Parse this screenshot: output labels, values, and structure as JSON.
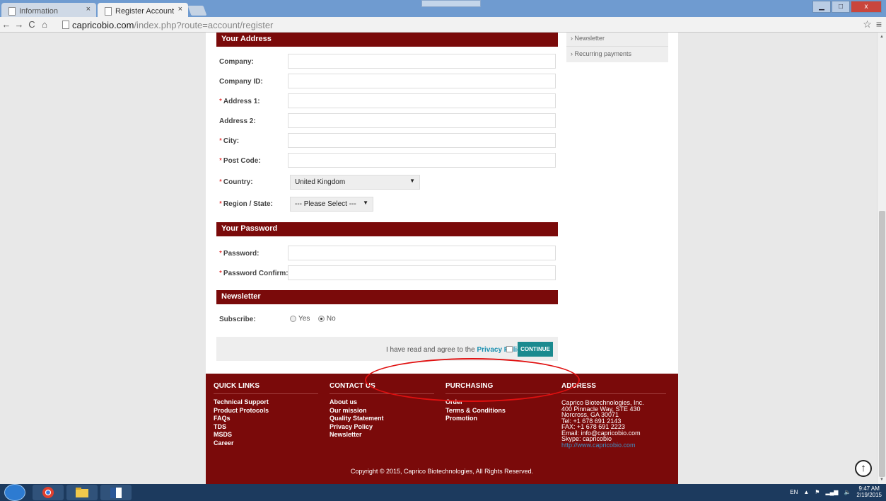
{
  "browser": {
    "tabs": [
      {
        "label": "Information"
      },
      {
        "label": "Register Account"
      }
    ],
    "close_glyph": "×",
    "url_host": "capricobio.com",
    "url_path": "/index.php?route=account/register",
    "win_controls": {
      "minimize": "▁",
      "maximize": "□",
      "close": "x"
    }
  },
  "sidebar": {
    "items": [
      {
        "label": "Newsletter"
      },
      {
        "label": "Recurring payments"
      }
    ]
  },
  "address_section": {
    "title": "Your Address",
    "fields": [
      {
        "label": "Company:",
        "required": false
      },
      {
        "label": "Company ID:",
        "required": false
      },
      {
        "label": "Address 1:",
        "required": true
      },
      {
        "label": "Address 2:",
        "required": false
      },
      {
        "label": "City:",
        "required": true
      },
      {
        "label": "Post Code:",
        "required": true
      }
    ],
    "country_label": "Country:",
    "country_value": "United Kingdom",
    "region_label": "Region / State:",
    "region_value": "--- Please Select ---"
  },
  "password_section": {
    "title": "Your Password",
    "password_label": "Password:",
    "confirm_label": "Password Confirm:"
  },
  "newsletter_section": {
    "title": "Newsletter",
    "subscribe_label": "Subscribe:",
    "yes_label": "Yes",
    "no_label": "No",
    "selected": "No"
  },
  "agree": {
    "text": "I have read and agree to the",
    "link": "Privacy Policy",
    "button": "CONTINUE"
  },
  "footer": {
    "quick_links": {
      "title": "QUICK LINKS",
      "items": [
        "Technical Support",
        "Product Protocols",
        "FAQs",
        "TDS",
        "MSDS",
        "Career"
      ]
    },
    "contact_us": {
      "title": "CONTACT US",
      "items": [
        "About us",
        "Our mission",
        "Quality Statement",
        "Privacy Policy",
        "Newsletter"
      ]
    },
    "purchasing": {
      "title": "PURCHASING",
      "items": [
        "Order",
        "Terms & Conditions",
        "Promotion"
      ]
    },
    "address": {
      "title": "ADDRESS",
      "lines": [
        "Caprico Biotechnologies, Inc.",
        "400 Pinnacle Way, STE 430",
        "Norcross, GA 30071",
        "Tel: +1 678 691 2143",
        "FAX: +1 678 691 2223",
        "Email: info@capricobio.com",
        "Skype: capricobio"
      ],
      "website": "http://www.capricobio.com"
    },
    "copyright": "Copyright © 2015, Caprico Biotechnologies, All Rights Reserved."
  },
  "taskbar": {
    "lang": "EN",
    "time": "9:47 AM",
    "date": "2/19/2015"
  },
  "colors": {
    "brand_maroon": "#7a0a0a",
    "continue_teal": "#1a8a8f",
    "link_blue": "#1a8fb0",
    "highlight_red": "#e01010"
  }
}
